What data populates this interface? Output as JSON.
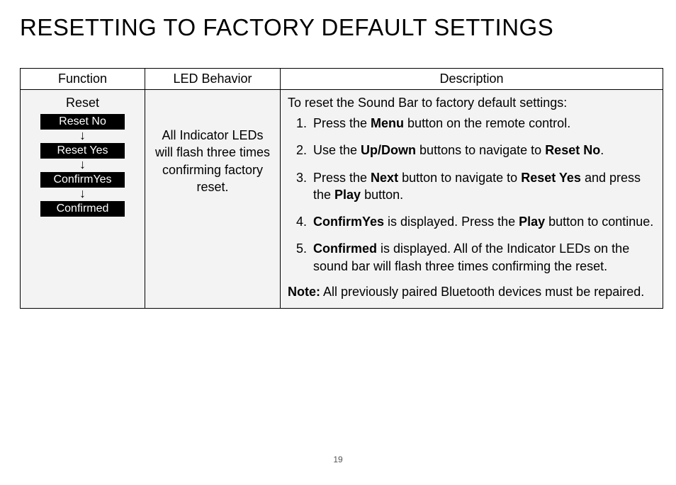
{
  "title": "RESETTING TO FACTORY DEFAULT SETTINGS",
  "headers": {
    "func": "Function",
    "led": "LED Behavior",
    "desc": "Description"
  },
  "func": {
    "top": "Reset",
    "steps": [
      "Reset No",
      "Reset Yes",
      "ConfirmYes",
      "Confirmed"
    ]
  },
  "led": "All Indicator LEDs will flash three times confirming factory reset.",
  "desc": {
    "intro": "To reset the Sound Bar to factory default settings:",
    "step1_a": "Press the ",
    "step1_b": "Menu",
    "step1_c": " button on the remote control.",
    "step2_a": "Use the ",
    "step2_b": "Up/Down",
    "step2_c": " buttons to navigate to ",
    "step2_d": "Reset No",
    "step2_e": ".",
    "step3_a": "Press the ",
    "step3_b": "Next",
    "step3_c": " button to navigate to ",
    "step3_d": "Reset Yes",
    "step3_e": " and press the ",
    "step3_f": "Play",
    "step3_g": " button.",
    "step4_a": "ConfirmYes",
    "step4_b": " is displayed. Press the ",
    "step4_c": "Play",
    "step4_d": " button to continue.",
    "step5_a": "Confirmed",
    "step5_b": " is displayed. All of the Indicator LEDs on the sound bar will flash three times confirming the reset.",
    "note_label": "Note:",
    "note_text": " All previously paired Bluetooth devices must be repaired."
  },
  "page_number": "19"
}
